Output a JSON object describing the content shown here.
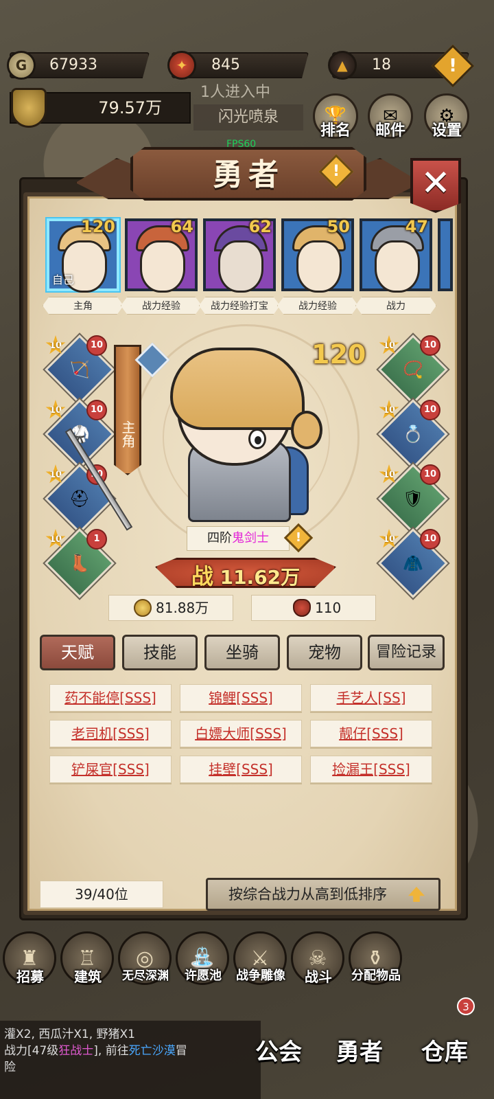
{
  "resources": {
    "gold": "67933",
    "medals": "845",
    "gems": "18",
    "total_power": "79.57万",
    "entering": "1人进入中",
    "location": "闪光喷泉"
  },
  "top_buttons": [
    {
      "label": "排名",
      "icon": "trophy-icon"
    },
    {
      "label": "邮件",
      "icon": "mail-icon"
    },
    {
      "label": "设置",
      "icon": "gear-icon"
    }
  ],
  "fps": "FPS60",
  "panel": {
    "title": "勇者",
    "close_label": "✕"
  },
  "heroes": [
    {
      "level": "120",
      "tag": "主角",
      "self": "自己",
      "color": "blue"
    },
    {
      "level": "64",
      "tag": "战力经验",
      "color": "purple"
    },
    {
      "level": "62",
      "tag": "战力经验打宝",
      "color": "purple"
    },
    {
      "level": "50",
      "tag": "战力经验",
      "color": "blue"
    },
    {
      "level": "47",
      "tag": "战力",
      "color": "blue"
    }
  ],
  "equipment": {
    "left": [
      {
        "star": "10",
        "badge": "10",
        "item": "crossbow"
      },
      {
        "star": "10",
        "badge": "10",
        "item": "armor"
      },
      {
        "star": "10",
        "badge": "10",
        "item": "helmet"
      },
      {
        "star": "10",
        "badge": "1",
        "item": "boots"
      }
    ],
    "right": [
      {
        "star": "10",
        "badge": "10",
        "item": "necklace"
      },
      {
        "star": "10",
        "badge": "10",
        "item": "ring"
      },
      {
        "star": "10",
        "badge": "10",
        "item": "shoulder"
      },
      {
        "star": "10",
        "badge": "10",
        "item": "cloak"
      }
    ]
  },
  "selected_hero": {
    "role": "主角",
    "level": "120",
    "rank": "四阶",
    "class": "鬼剑士",
    "power_prefix": "战",
    "power": "11.62万",
    "gold": "81.88万",
    "medals": "110"
  },
  "tabs": [
    "天赋",
    "技能",
    "坐骑",
    "宠物",
    "冒险记录"
  ],
  "talents": [
    "药不能停[SSS]",
    "锦鲤[SSS]",
    "手艺人[SS]",
    "老司机[SSS]",
    "白嫖大师[SSS]",
    "靓仔[SSS]",
    "铲屎官[SSS]",
    "挂壁[SSS]",
    "捡漏王[SSS]"
  ],
  "roster_count": "39/40位",
  "sort_label": "按综合战力从高到低排序",
  "bottom_nav": [
    "招募",
    "建筑",
    "无尽深渊",
    "许愿池",
    "战争雕像",
    "战斗",
    "分配物品"
  ],
  "chat": {
    "line1": "灌X2, 西瓜汁X1, 野猪X1",
    "line2_prefix": "战力[47级",
    "line2_hero": "狂战士",
    "line2_mid": "], 前往",
    "line2_place": "死亡沙漠",
    "line2_suffix": "冒",
    "line3": "险"
  },
  "main_tabs": [
    "公会",
    "勇者",
    "仓库"
  ],
  "notification_count": "3"
}
